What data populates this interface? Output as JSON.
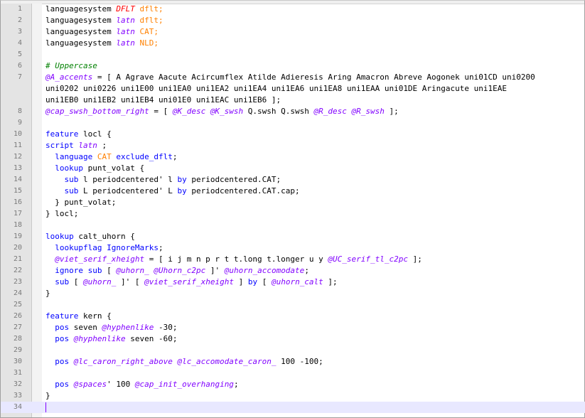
{
  "editor": {
    "line_numbers": [
      "1",
      "2",
      "3",
      "4",
      "5",
      "6",
      "7",
      "",
      "",
      "8",
      "9",
      "10",
      "11",
      "12",
      "13",
      "14",
      "15",
      "16",
      "17",
      "18",
      "19",
      "20",
      "21",
      "22",
      "23",
      "24",
      "25",
      "26",
      "27",
      "28",
      "29",
      "30",
      "31",
      "32",
      "33",
      "34"
    ],
    "lines": [
      [
        {
          "t": "languagesystem ",
          "c": ""
        },
        {
          "t": "DFLT",
          "c": "d"
        },
        {
          "t": " dflt;",
          "c": "o"
        }
      ],
      [
        {
          "t": "languagesystem ",
          "c": ""
        },
        {
          "t": "latn",
          "c": "i"
        },
        {
          "t": " dflt;",
          "c": "o"
        }
      ],
      [
        {
          "t": "languagesystem ",
          "c": ""
        },
        {
          "t": "latn",
          "c": "i"
        },
        {
          "t": " CAT;",
          "c": "o"
        }
      ],
      [
        {
          "t": "languagesystem ",
          "c": ""
        },
        {
          "t": "latn",
          "c": "i"
        },
        {
          "t": " NLD;",
          "c": "o"
        }
      ],
      [],
      [
        {
          "t": "# Uppercase",
          "c": "c"
        }
      ],
      [
        {
          "t": "@A_accents",
          "c": "v"
        },
        {
          "t": " = [ A Agrave Aacute Acircumflex Atilde Adieresis Aring Amacron Abreve Aogonek uni01CD uni0200",
          "c": ""
        }
      ],
      [
        {
          "t": "uni0202 uni0226 uni1E00 uni1EA0 uni1EA2 uni1EA4 uni1EA6 uni1EA8 uni1EAA uni01DE Aringacute uni1EAE",
          "c": ""
        }
      ],
      [
        {
          "t": "uni1EB0 uni1EB2 uni1EB4 uni01E0 uni1EAC uni1EB6 ];",
          "c": ""
        }
      ],
      [
        {
          "t": "@cap_swsh_bottom_right",
          "c": "v"
        },
        {
          "t": " = [ ",
          "c": ""
        },
        {
          "t": "@K_desc",
          "c": "v"
        },
        {
          "t": " ",
          "c": ""
        },
        {
          "t": "@K_swsh",
          "c": "v"
        },
        {
          "t": " Q.swsh Q.swsh ",
          "c": ""
        },
        {
          "t": "@R_desc",
          "c": "v"
        },
        {
          "t": " ",
          "c": ""
        },
        {
          "t": "@R_swsh",
          "c": "v"
        },
        {
          "t": " ];",
          "c": ""
        }
      ],
      [],
      [
        {
          "t": "feature",
          "c": "kw"
        },
        {
          "t": " locl {",
          "c": ""
        }
      ],
      [
        {
          "t": "script",
          "c": "kw"
        },
        {
          "t": " ",
          "c": ""
        },
        {
          "t": "latn",
          "c": "i"
        },
        {
          "t": " ;",
          "c": ""
        }
      ],
      [
        {
          "t": "  ",
          "c": ""
        },
        {
          "t": "language",
          "c": "kw"
        },
        {
          "t": " ",
          "c": ""
        },
        {
          "t": "CAT",
          "c": "o"
        },
        {
          "t": " ",
          "c": ""
        },
        {
          "t": "exclude_dflt",
          "c": "kw"
        },
        {
          "t": ";",
          "c": ""
        }
      ],
      [
        {
          "t": "  ",
          "c": ""
        },
        {
          "t": "lookup",
          "c": "kw"
        },
        {
          "t": " punt_volat {",
          "c": ""
        }
      ],
      [
        {
          "t": "    ",
          "c": ""
        },
        {
          "t": "sub",
          "c": "kw"
        },
        {
          "t": " l periodcentered' l ",
          "c": ""
        },
        {
          "t": "by",
          "c": "kw"
        },
        {
          "t": " periodcentered.CAT;",
          "c": ""
        }
      ],
      [
        {
          "t": "    ",
          "c": ""
        },
        {
          "t": "sub",
          "c": "kw"
        },
        {
          "t": " L periodcentered' L ",
          "c": ""
        },
        {
          "t": "by",
          "c": "kw"
        },
        {
          "t": " periodcentered.CAT.cap;",
          "c": ""
        }
      ],
      [
        {
          "t": "  } punt_volat;",
          "c": ""
        }
      ],
      [
        {
          "t": "} locl;",
          "c": ""
        }
      ],
      [],
      [
        {
          "t": "lookup",
          "c": "kw"
        },
        {
          "t": " calt_uhorn {",
          "c": ""
        }
      ],
      [
        {
          "t": "  ",
          "c": ""
        },
        {
          "t": "lookupflag",
          "c": "kw"
        },
        {
          "t": " ",
          "c": ""
        },
        {
          "t": "IgnoreMarks",
          "c": "kw"
        },
        {
          "t": ";",
          "c": ""
        }
      ],
      [
        {
          "t": "  ",
          "c": ""
        },
        {
          "t": "@viet_serif_xheight",
          "c": "v"
        },
        {
          "t": " = [ i j m n p r t t.long t.longer u y ",
          "c": ""
        },
        {
          "t": "@UC_serif_tl_c2pc",
          "c": "v"
        },
        {
          "t": " ];",
          "c": ""
        }
      ],
      [
        {
          "t": "  ",
          "c": ""
        },
        {
          "t": "ignore",
          "c": "kw"
        },
        {
          "t": " ",
          "c": ""
        },
        {
          "t": "sub",
          "c": "kw"
        },
        {
          "t": " [ ",
          "c": ""
        },
        {
          "t": "@uhorn_",
          "c": "v"
        },
        {
          "t": " ",
          "c": ""
        },
        {
          "t": "@Uhorn_c2pc",
          "c": "v"
        },
        {
          "t": " ]' ",
          "c": ""
        },
        {
          "t": "@uhorn_accomodate",
          "c": "v"
        },
        {
          "t": ";",
          "c": ""
        }
      ],
      [
        {
          "t": "  ",
          "c": ""
        },
        {
          "t": "sub",
          "c": "kw"
        },
        {
          "t": " [ ",
          "c": ""
        },
        {
          "t": "@uhorn_",
          "c": "v"
        },
        {
          "t": " ]' [ ",
          "c": ""
        },
        {
          "t": "@viet_serif_xheight",
          "c": "v"
        },
        {
          "t": " ] ",
          "c": ""
        },
        {
          "t": "by",
          "c": "kw"
        },
        {
          "t": " [ ",
          "c": ""
        },
        {
          "t": "@uhorn_calt",
          "c": "v"
        },
        {
          "t": " ];",
          "c": ""
        }
      ],
      [
        {
          "t": "}",
          "c": ""
        }
      ],
      [],
      [
        {
          "t": "feature",
          "c": "kw"
        },
        {
          "t": " kern {",
          "c": ""
        }
      ],
      [
        {
          "t": "  ",
          "c": ""
        },
        {
          "t": "pos",
          "c": "kw"
        },
        {
          "t": " seven ",
          "c": ""
        },
        {
          "t": "@hyphenlike",
          "c": "v"
        },
        {
          "t": " -30;",
          "c": ""
        }
      ],
      [
        {
          "t": "  ",
          "c": ""
        },
        {
          "t": "pos",
          "c": "kw"
        },
        {
          "t": " ",
          "c": ""
        },
        {
          "t": "@hyphenlike",
          "c": "v"
        },
        {
          "t": " seven -60;",
          "c": ""
        }
      ],
      [],
      [
        {
          "t": "  ",
          "c": ""
        },
        {
          "t": "pos",
          "c": "kw"
        },
        {
          "t": " ",
          "c": ""
        },
        {
          "t": "@lc_caron_right_above",
          "c": "v"
        },
        {
          "t": " ",
          "c": ""
        },
        {
          "t": "@lc_accomodate_caron_",
          "c": "v"
        },
        {
          "t": " 100 -100;",
          "c": ""
        }
      ],
      [],
      [
        {
          "t": "  ",
          "c": ""
        },
        {
          "t": "pos",
          "c": "kw"
        },
        {
          "t": " ",
          "c": ""
        },
        {
          "t": "@spaces",
          "c": "v"
        },
        {
          "t": "' 100 ",
          "c": ""
        },
        {
          "t": "@cap_init_overhanging",
          "c": "v"
        },
        {
          "t": ";",
          "c": ""
        }
      ],
      [
        {
          "t": "}",
          "c": ""
        }
      ],
      []
    ],
    "caret_line_index": 35
  },
  "colors": {
    "keyword": "#0000ff",
    "variable": "#8000ff",
    "operator_value": "#ff8000",
    "comment": "#008000",
    "dflt_tag": "#ff0000",
    "current_line": "#e8e8ff",
    "gutter": "#e4e4e4"
  }
}
